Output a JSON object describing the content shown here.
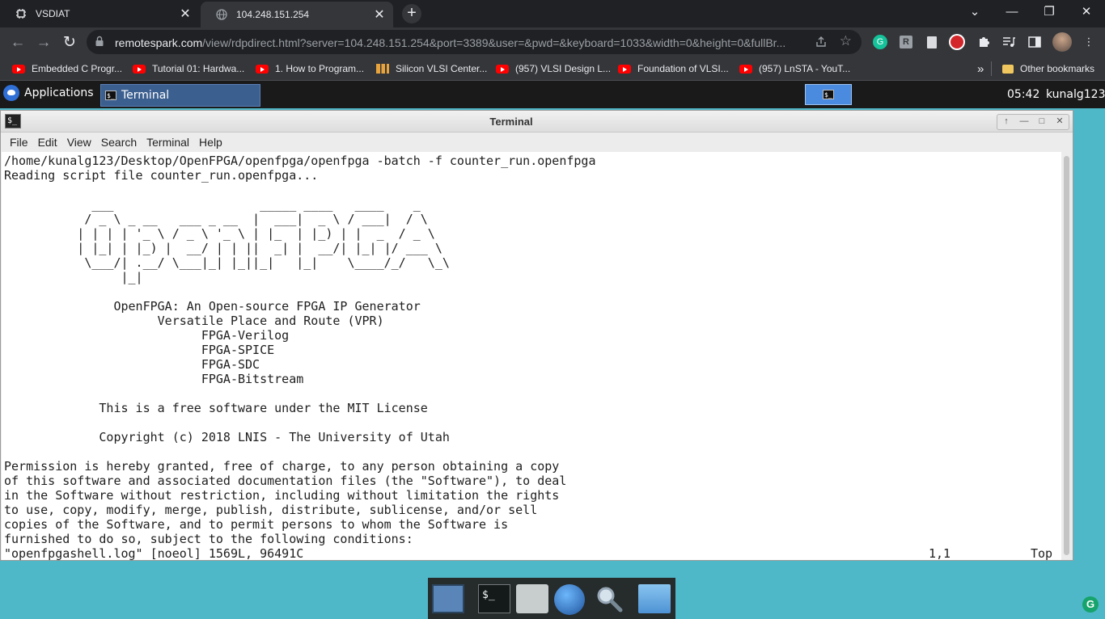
{
  "browser": {
    "tabs": [
      {
        "title": "VSDIAT",
        "active": false
      },
      {
        "title": "104.248.151.254",
        "active": true
      }
    ],
    "new_tab": "+",
    "window_controls": {
      "chevron": "⌄",
      "minimize": "—",
      "restore": "❐",
      "close": "✕"
    },
    "address": {
      "host": "remotespark.com",
      "path": "/view/rdpdirect.html?server=104.248.151.254&port=3389&user=&pwd=&keyboard=1033&width=0&height=0&fullBr..."
    },
    "extensions": [
      "grammarly-icon",
      "r-icon",
      "doc-icon",
      "adblock-icon",
      "puzzle-icon",
      "playlist-icon",
      "sidepanel-icon",
      "avatar",
      "kebab-menu-icon"
    ],
    "bookmarks": [
      {
        "label": "Embedded C Progr...",
        "icon": "youtube-icon"
      },
      {
        "label": "Tutorial 01: Hardwa...",
        "icon": "youtube-icon"
      },
      {
        "label": "1. How to Program...",
        "icon": "youtube-icon"
      },
      {
        "label": "Silicon VLSI Center...",
        "icon": "silicon-icon"
      },
      {
        "label": "(957) VLSI Design L...",
        "icon": "youtube-icon"
      },
      {
        "label": "Foundation of VLSI...",
        "icon": "youtube-icon"
      },
      {
        "label": "(957) LnSTA - YouT...",
        "icon": "youtube-icon"
      }
    ],
    "bookmarks_overflow": "»",
    "other_bookmarks": "Other bookmarks"
  },
  "panel": {
    "applications_label": "Applications",
    "task_label": "Terminal",
    "clock": "05:42",
    "user": "kunalg123"
  },
  "terminal": {
    "window_title": "Terminal",
    "title_buttons": [
      "↑",
      "—",
      "□",
      "✕"
    ],
    "menu": [
      "File",
      "Edit",
      "View",
      "Search",
      "Terminal",
      "Help"
    ],
    "lines": [
      "/home/kunalg123/Desktop/OpenFPGA/openfpga/openfpga -batch -f counter_run.openfpga",
      "Reading script file counter_run.openfpga...",
      "",
      "            ___                    _____ ____   ____    _",
      "           / _ \\ _ __   ___ _ __  |  ___|  _ \\ / ___|  / \\",
      "          | | | | '_ \\ / _ \\ '_ \\ | |_  | |_) | |  _  / _ \\",
      "          | |_| | |_) |  __/ | | ||  _| |  __/| |_| |/ ___ \\",
      "           \\___/| .__/ \\___|_| |_||_|   |_|    \\____/_/   \\_\\",
      "                |_|",
      "",
      "               OpenFPGA: An Open-source FPGA IP Generator",
      "                     Versatile Place and Route (VPR)",
      "                           FPGA-Verilog",
      "                           FPGA-SPICE",
      "                           FPGA-SDC",
      "                           FPGA-Bitstream",
      "",
      "             This is a free software under the MIT License",
      "",
      "             Copyright (c) 2018 LNIS - The University of Utah",
      "",
      "Permission is hereby granted, free of charge, to any person obtaining a copy",
      "of this software and associated documentation files (the \"Software\"), to deal",
      "in the Software without restriction, including without limitation the rights",
      "to use, copy, modify, merge, publish, distribute, sublicense, and/or sell",
      "copies of the Software, and to permit persons to whom the Software is",
      "furnished to do so, subject to the following conditions:"
    ],
    "status": {
      "file": "\"openfpgashell.log\" [noeol] 1569L, 96491C",
      "position": "1,1",
      "scroll": "Top"
    }
  },
  "dock": [
    "desktop-icon",
    "terminal-icon",
    "home-folder-icon",
    "web-browser-icon",
    "search-icon",
    "file-manager-icon"
  ],
  "colors": {
    "desktop": "#4fb8c8",
    "chrome_dark": "#202124",
    "chrome_toolbar": "#35363a",
    "panel": "#1a1a1a",
    "task_active": "#3b5f8f",
    "workspace": "#4a8be0"
  }
}
